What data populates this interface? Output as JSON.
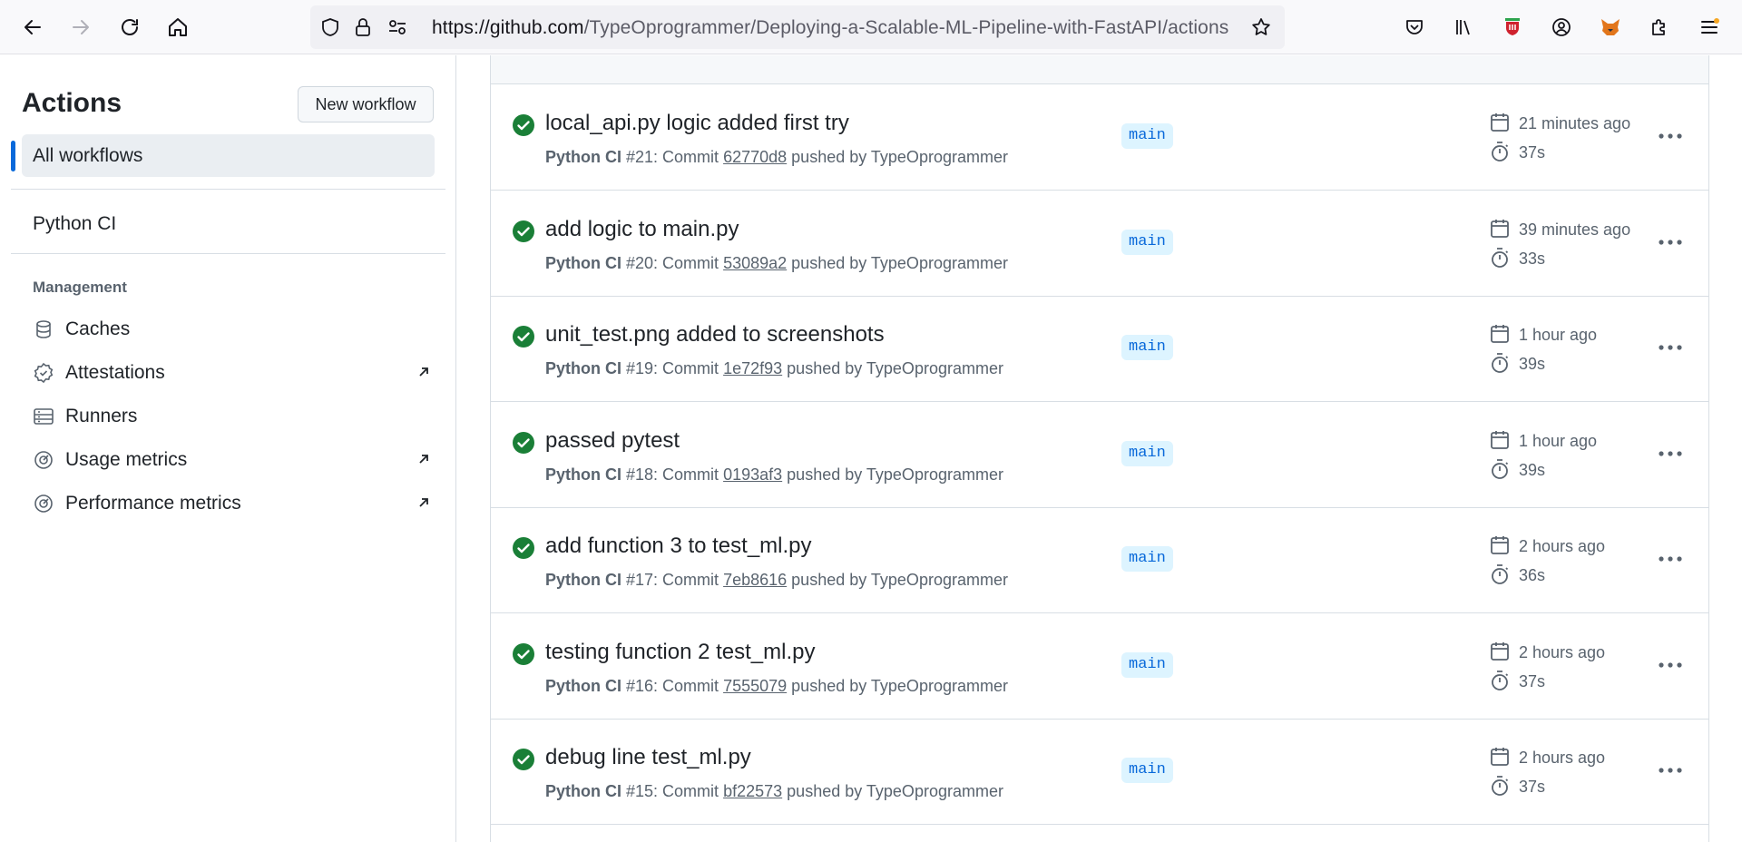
{
  "browser": {
    "url_host": "https://github.com",
    "url_path": "/TypeOprogrammer/Deploying-a-Scalable-ML-Pipeline-with-FastAPI/actions",
    "icons": [
      "back-icon",
      "forward-icon",
      "reload-icon",
      "home-icon",
      "shield-icon",
      "lock-icon",
      "permissions-icon",
      "bookmark-star-icon",
      "pocket-icon",
      "library-icon",
      "extension-shield-icon",
      "account-icon",
      "fox-extension-icon",
      "extensions-icon",
      "menu-icon"
    ]
  },
  "sidebar": {
    "title": "Actions",
    "new_workflow": "New workflow",
    "all_workflows": "All workflows",
    "workflow": "Python CI",
    "management_heading": "Management",
    "management_items": [
      {
        "label": "Caches",
        "icon": "database-icon"
      },
      {
        "label": "Attestations",
        "icon": "verified-icon"
      },
      {
        "label": "Runners",
        "icon": "server-icon"
      },
      {
        "label": "Usage metrics",
        "icon": "meter-icon"
      },
      {
        "label": "Performance metrics",
        "icon": "meter-icon"
      }
    ]
  },
  "runs": [
    {
      "title": "local_api.py logic added first try",
      "workflow": "Python CI",
      "run": "#21: Commit",
      "sha": "62770d8",
      "pushed_by": "pushed by TypeOprogrammer",
      "branch": "main",
      "when": "21 minutes ago",
      "duration": "37s"
    },
    {
      "title": "add logic to main.py",
      "workflow": "Python CI",
      "run": "#20: Commit",
      "sha": "53089a2",
      "pushed_by": "pushed by TypeOprogrammer",
      "branch": "main",
      "when": "39 minutes ago",
      "duration": "33s"
    },
    {
      "title": "unit_test.png added to screenshots",
      "workflow": "Python CI",
      "run": "#19: Commit",
      "sha": "1e72f93",
      "pushed_by": "pushed by TypeOprogrammer",
      "branch": "main",
      "when": "1 hour ago",
      "duration": "39s"
    },
    {
      "title": "passed pytest",
      "workflow": "Python CI",
      "run": "#18: Commit",
      "sha": "0193af3",
      "pushed_by": "pushed by TypeOprogrammer",
      "branch": "main",
      "when": "1 hour ago",
      "duration": "39s"
    },
    {
      "title": "add function 3 to test_ml.py",
      "workflow": "Python CI",
      "run": "#17: Commit",
      "sha": "7eb8616",
      "pushed_by": "pushed by TypeOprogrammer",
      "branch": "main",
      "when": "2 hours ago",
      "duration": "36s"
    },
    {
      "title": "testing function 2 test_ml.py",
      "workflow": "Python CI",
      "run": "#16: Commit",
      "sha": "7555079",
      "pushed_by": "pushed by TypeOprogrammer",
      "branch": "main",
      "when": "2 hours ago",
      "duration": "37s"
    },
    {
      "title": "debug line test_ml.py",
      "workflow": "Python CI",
      "run": "#15: Commit",
      "sha": "bf22573",
      "pushed_by": "pushed by TypeOprogrammer",
      "branch": "main",
      "when": "2 hours ago",
      "duration": "37s"
    }
  ],
  "colors": {
    "success": "#1a7f37",
    "accent": "#0969da",
    "branch_bg": "#ddf4ff"
  }
}
